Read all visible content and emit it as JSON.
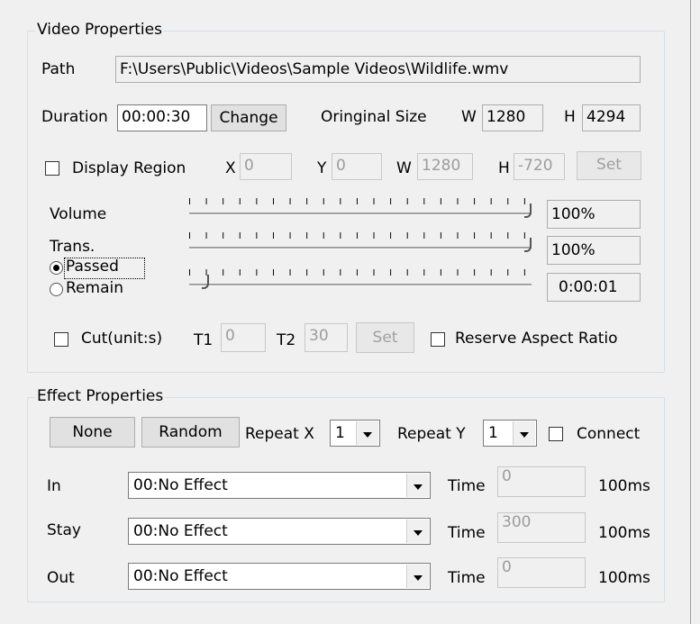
{
  "video": {
    "group_title": "Video Properties",
    "path_label": "Path",
    "path_value": "F:\\Users\\Public\\Videos\\Sample Videos\\Wildlife.wmv",
    "duration_label": "Duration",
    "duration_value": "00:00:30",
    "change_label": "Change",
    "original_size_label": "Oringinal Size",
    "w_label": "W",
    "w_value": "1280",
    "h_label": "H",
    "h_value": "4294",
    "display_region_label": "Display Region",
    "display_region_checked": false,
    "x_label": "X",
    "x_value": "0",
    "y_label": "Y",
    "y_value": "0",
    "dr_w_label": "W",
    "dr_w_value": "1280",
    "dr_h_label": "H",
    "dr_h_value": "-720",
    "set_label": "Set",
    "volume_label": "Volume",
    "volume_value": "100%",
    "volume_level": 1.0,
    "trans_label": "Trans.",
    "trans_value": "100%",
    "trans_level": 1.0,
    "passed_label": "Passed",
    "remain_label": "Remain",
    "time_mode_selected": "Passed",
    "position_value": "0:00:01",
    "position_fraction": 0.033,
    "cut_label": "Cut(unit:s)",
    "cut_checked": false,
    "t1_label": "T1",
    "t1_value": "0",
    "t2_label": "T2",
    "t2_value": "30",
    "cut_set_label": "Set",
    "reserve_aspect_label": "Reserve Aspect Ratio",
    "reserve_aspect_checked": false
  },
  "effect": {
    "group_title": "Effect Properties",
    "none_label": "None",
    "random_label": "Random",
    "repeat_x_label": "Repeat X",
    "repeat_x_value": "1",
    "repeat_y_label": "Repeat Y",
    "repeat_y_value": "1",
    "connect_label": "Connect",
    "connect_checked": false,
    "rows": [
      {
        "label": "In",
        "effect": "00:No Effect",
        "time_label": "Time",
        "time_value": "0",
        "unit": "100ms"
      },
      {
        "label": "Stay",
        "effect": "00:No Effect",
        "time_label": "Time",
        "time_value": "300",
        "unit": "100ms"
      },
      {
        "label": "Out",
        "effect": "00:No Effect",
        "time_label": "Time",
        "time_value": "0",
        "unit": "100ms"
      }
    ]
  }
}
